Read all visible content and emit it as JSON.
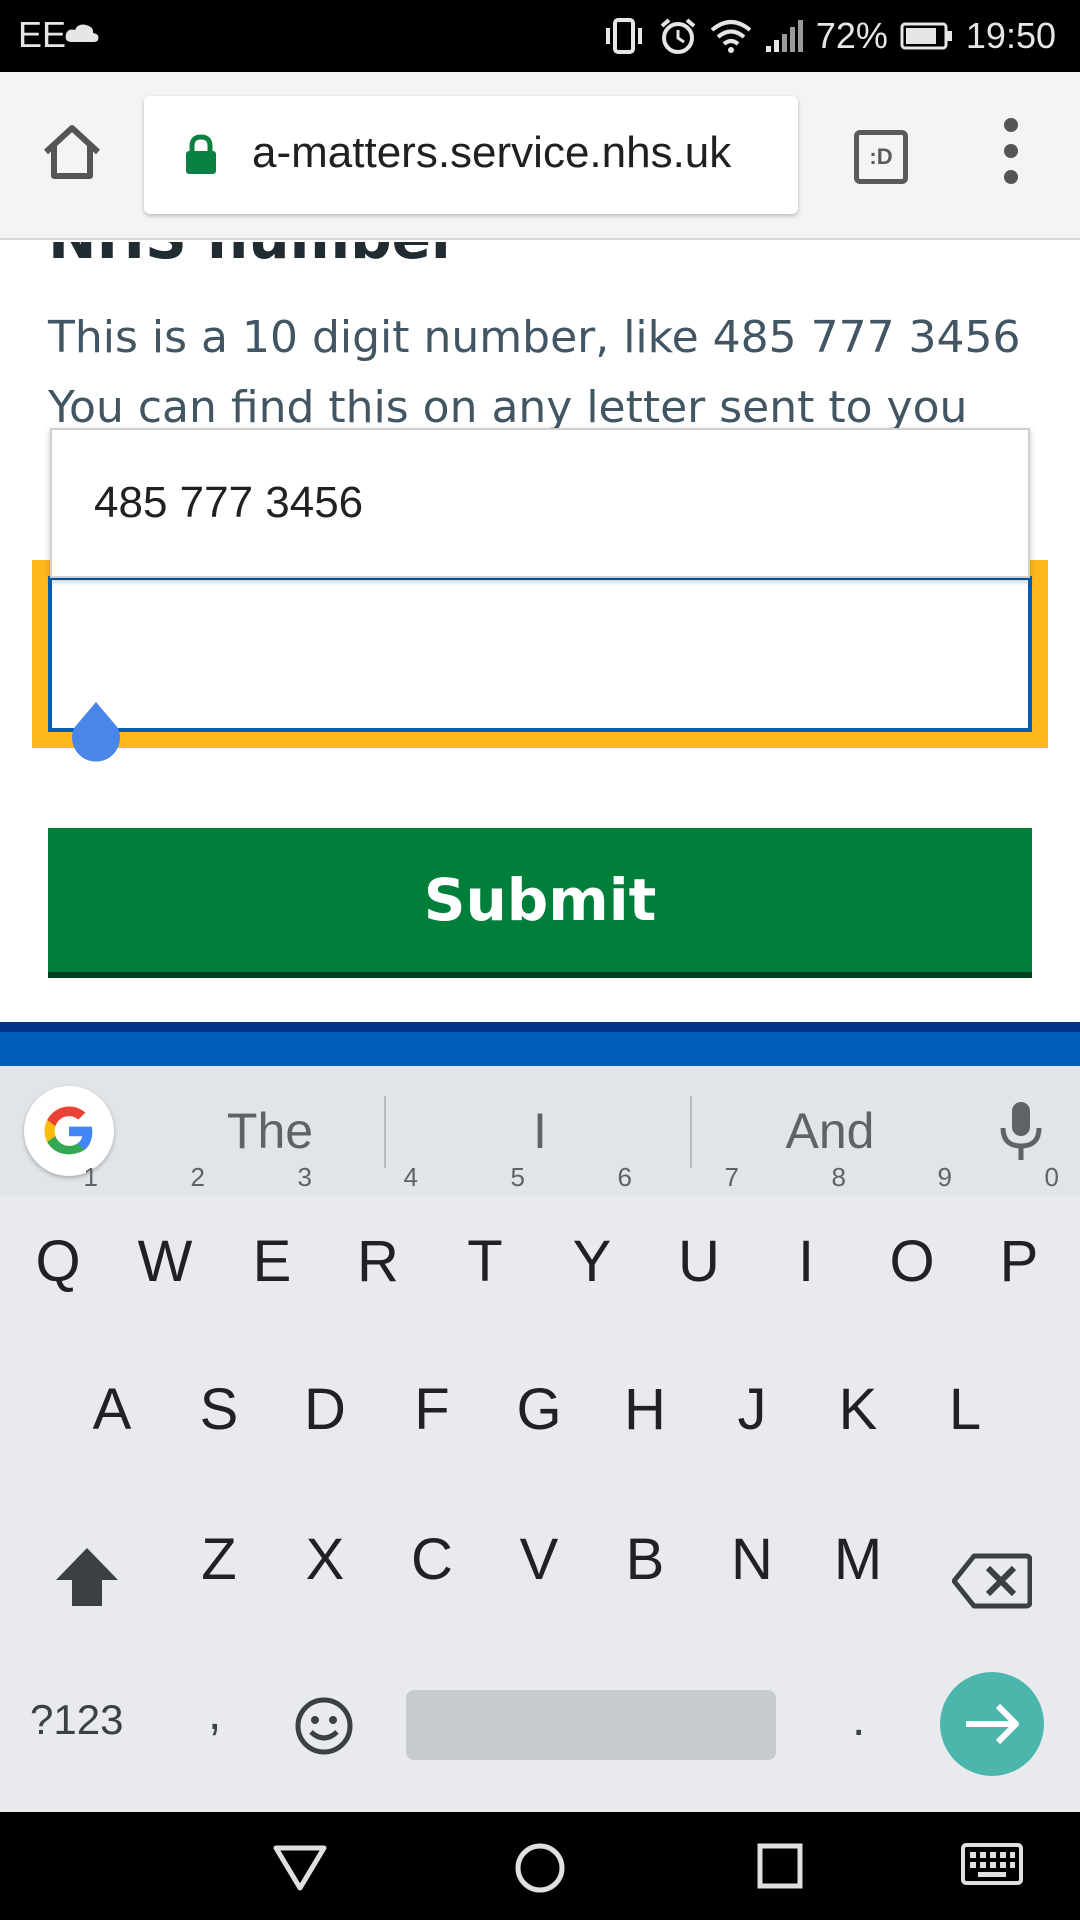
{
  "status_bar": {
    "carrier": "EE",
    "battery": "72%",
    "time": "19:50"
  },
  "browser": {
    "url": "a-matters.service.nhs.uk",
    "tabs_label": ":D"
  },
  "form": {
    "heading": "NHS number",
    "hint_line1": "This is a 10 digit number, like 485 777 3456",
    "hint_line2": "You can find this on any letter sent to you",
    "autofill_suggestion": "485 777 3456",
    "input_value": "",
    "submit_label": "Submit"
  },
  "keyboard": {
    "suggestions": [
      "The",
      "I",
      "And"
    ],
    "row1": [
      {
        "key": "Q",
        "sup": "1"
      },
      {
        "key": "W",
        "sup": "2"
      },
      {
        "key": "E",
        "sup": "3"
      },
      {
        "key": "R",
        "sup": "4"
      },
      {
        "key": "T",
        "sup": "5"
      },
      {
        "key": "Y",
        "sup": "6"
      },
      {
        "key": "U",
        "sup": "7"
      },
      {
        "key": "I",
        "sup": "8"
      },
      {
        "key": "O",
        "sup": "9"
      },
      {
        "key": "P",
        "sup": "0"
      }
    ],
    "row2": [
      "A",
      "S",
      "D",
      "F",
      "G",
      "H",
      "J",
      "K",
      "L"
    ],
    "row3": [
      "Z",
      "X",
      "C",
      "V",
      "B",
      "N",
      "M"
    ],
    "symbols_label": "?123",
    "comma": ",",
    "period": "."
  },
  "colors": {
    "nhs_blue": "#005eb8",
    "nhs_green": "#007f3b",
    "focus_yellow": "#ffb81c",
    "enter_teal": "#4db6ac"
  }
}
